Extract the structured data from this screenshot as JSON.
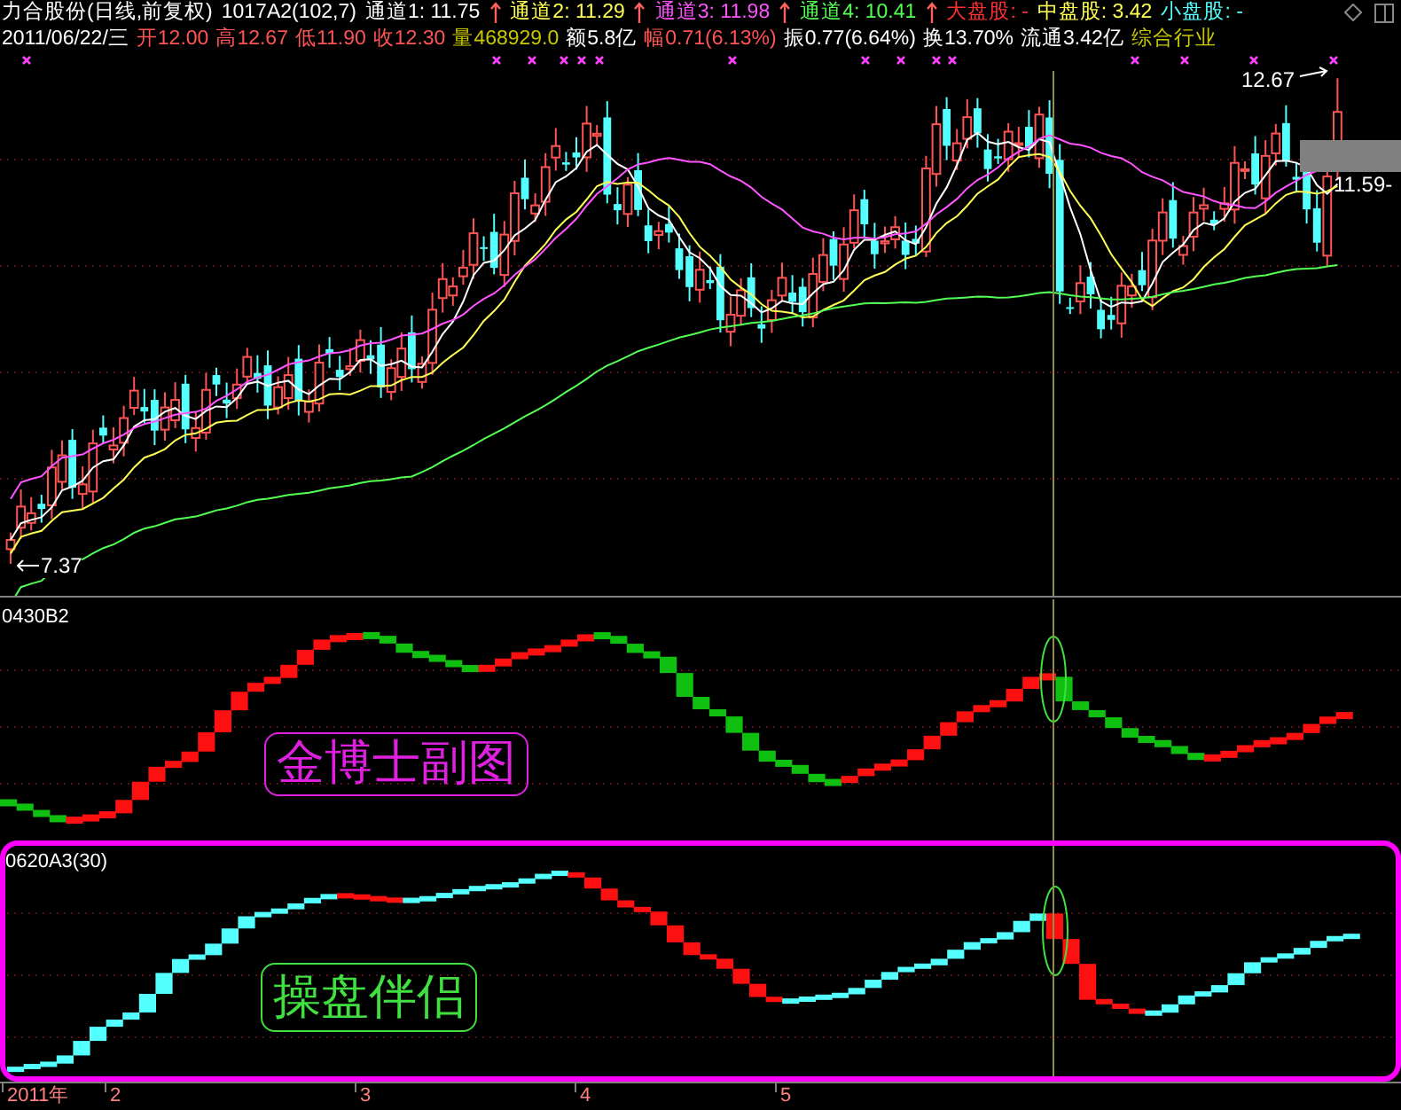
{
  "stock_header": {
    "title": "力合股份(日线,前复权)",
    "formula": "1017A2(102,7)",
    "channels": [
      {
        "label": "通道1: 11.75",
        "color": "#ffffff"
      },
      {
        "label": "通道2: 11.29",
        "color": "#ffff54"
      },
      {
        "label": "通道3: 11.98",
        "color": "#ff54ff"
      },
      {
        "label": "通道4: 10.41",
        "color": "#54ff54"
      }
    ],
    "caps": [
      {
        "label": "大盘股: -",
        "color": "#ff3030"
      },
      {
        "label": "中盘股: 3.42",
        "color": "#ffff54"
      },
      {
        "label": "小盘股: -",
        "color": "#54ffff"
      }
    ]
  },
  "quote": {
    "date": "2011/06/22/三",
    "fields": [
      {
        "label": "开",
        "value": "12.00",
        "color": "#ff5454"
      },
      {
        "label": "高",
        "value": "12.67",
        "color": "#ff5454"
      },
      {
        "label": "低",
        "value": "11.90",
        "color": "#ff5454"
      },
      {
        "label": "收",
        "value": "12.30",
        "color": "#ff5454"
      },
      {
        "label": "量",
        "value": "468929.0",
        "color": "#c8c800"
      },
      {
        "label": "额",
        "value": "5.8亿",
        "color": "#ffffff"
      },
      {
        "label": "幅",
        "value": "0.71(6.13%)",
        "color": "#ff5454"
      },
      {
        "label": "振",
        "value": "0.77(6.64%)",
        "color": "#ffffff"
      },
      {
        "label": "换",
        "value": "13.70%",
        "color": "#ffffff"
      },
      {
        "label": "流通",
        "value": "3.42亿",
        "color": "#ffffff"
      }
    ],
    "industry": "综合行业"
  },
  "price_labels": {
    "high": "12.67",
    "current": "11.59-",
    "low": "7.37"
  },
  "panels": [
    {
      "name": "0430B2",
      "caption": "金博士副图"
    },
    {
      "name": "0620A3(30)",
      "caption": "操盘伴侣"
    }
  ],
  "time_axis": [
    "2011年",
    "2",
    "3",
    "4",
    "5"
  ]
}
